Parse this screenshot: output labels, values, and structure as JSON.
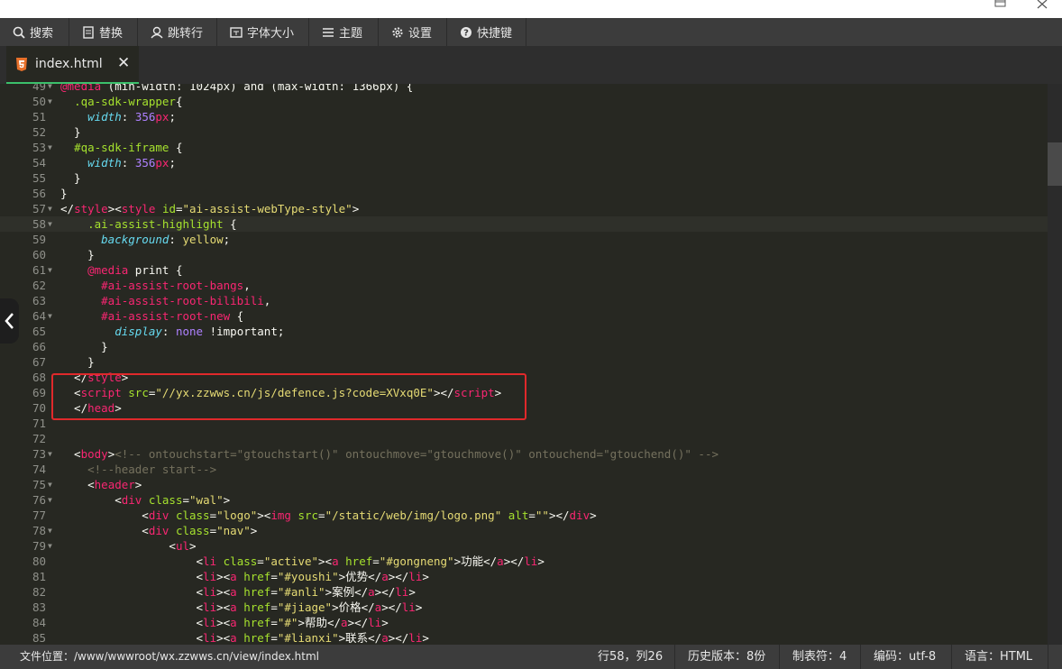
{
  "toolbar": {
    "search": "搜索",
    "replace": "替换",
    "goto_line": "跳转行",
    "font_size": "字体大小",
    "theme": "主题",
    "settings": "设置",
    "shortcuts": "快捷键"
  },
  "tab": {
    "filename": "index.html",
    "close": "✕"
  },
  "editor": {
    "lines": [
      {
        "n": "49",
        "fold": true,
        "code": [
          [
            "t",
            "@media"
          ],
          [
            "w",
            " (min-width: 1024px) and (max-width: 1366px) {"
          ]
        ]
      },
      {
        "n": "50",
        "fold": true,
        "code": [
          [
            "w",
            "  "
          ],
          [
            "a",
            ".qa-sdk-wrapper"
          ],
          [
            "w",
            "{"
          ]
        ]
      },
      {
        "n": "51",
        "fold": false,
        "code": [
          [
            "w",
            "    "
          ],
          [
            "k",
            "width"
          ],
          [
            "w",
            ": "
          ],
          [
            "n",
            "356"
          ],
          [
            "t",
            "px"
          ],
          [
            "w",
            ";"
          ]
        ]
      },
      {
        "n": "52",
        "fold": false,
        "code": [
          [
            "w",
            "  }"
          ]
        ]
      },
      {
        "n": "53",
        "fold": true,
        "code": [
          [
            "w",
            "  "
          ],
          [
            "a",
            "#qa-sdk-iframe"
          ],
          [
            "w",
            " {"
          ]
        ]
      },
      {
        "n": "54",
        "fold": false,
        "code": [
          [
            "w",
            "    "
          ],
          [
            "k",
            "width"
          ],
          [
            "w",
            ": "
          ],
          [
            "n",
            "356"
          ],
          [
            "t",
            "px"
          ],
          [
            "w",
            ";"
          ]
        ]
      },
      {
        "n": "55",
        "fold": false,
        "code": [
          [
            "w",
            "  }"
          ]
        ]
      },
      {
        "n": "56",
        "fold": false,
        "code": [
          [
            "w",
            "}"
          ]
        ]
      },
      {
        "n": "57",
        "fold": true,
        "code": [
          [
            "w",
            "</"
          ],
          [
            "t",
            "style"
          ],
          [
            "w",
            "><"
          ],
          [
            "t",
            "style"
          ],
          [
            "w",
            " "
          ],
          [
            "a",
            "id"
          ],
          [
            "w",
            "="
          ],
          [
            "s",
            "\"ai-assist-webType-style\""
          ],
          [
            "w",
            ">"
          ]
        ]
      },
      {
        "n": "58",
        "fold": true,
        "active": true,
        "code": [
          [
            "w",
            "    "
          ],
          [
            "a",
            ".ai-assist-highlight"
          ],
          [
            "w",
            " {"
          ]
        ]
      },
      {
        "n": "59",
        "fold": false,
        "code": [
          [
            "w",
            "      "
          ],
          [
            "k",
            "background"
          ],
          [
            "w",
            ": "
          ],
          [
            "s",
            "yellow"
          ],
          [
            "w",
            ";"
          ]
        ]
      },
      {
        "n": "60",
        "fold": false,
        "code": [
          [
            "w",
            "    }"
          ]
        ]
      },
      {
        "n": "61",
        "fold": true,
        "code": [
          [
            "w",
            "    "
          ],
          [
            "t",
            "@media"
          ],
          [
            "w",
            " print {"
          ]
        ]
      },
      {
        "n": "62",
        "fold": false,
        "code": [
          [
            "w",
            "      "
          ],
          [
            "t",
            "#ai-assist-root-bangs"
          ],
          [
            "w",
            ","
          ]
        ]
      },
      {
        "n": "63",
        "fold": false,
        "code": [
          [
            "w",
            "      "
          ],
          [
            "t",
            "#ai-assist-root-bilibili"
          ],
          [
            "w",
            ","
          ]
        ]
      },
      {
        "n": "64",
        "fold": true,
        "code": [
          [
            "w",
            "      "
          ],
          [
            "t",
            "#ai-assist-root-new"
          ],
          [
            "w",
            " {"
          ]
        ]
      },
      {
        "n": "65",
        "fold": false,
        "code": [
          [
            "w",
            "        "
          ],
          [
            "k",
            "display"
          ],
          [
            "w",
            ": "
          ],
          [
            "n",
            "none"
          ],
          [
            "w",
            " !important;"
          ]
        ]
      },
      {
        "n": "66",
        "fold": false,
        "code": [
          [
            "w",
            "      }"
          ]
        ]
      },
      {
        "n": "67",
        "fold": false,
        "code": [
          [
            "w",
            "    }"
          ]
        ]
      },
      {
        "n": "68",
        "fold": false,
        "code": [
          [
            "w",
            "  </"
          ],
          [
            "t",
            "style"
          ],
          [
            "w",
            ">"
          ]
        ]
      },
      {
        "n": "69",
        "fold": false,
        "code": [
          [
            "w",
            "  <"
          ],
          [
            "t",
            "script"
          ],
          [
            "w",
            " "
          ],
          [
            "a",
            "src"
          ],
          [
            "w",
            "="
          ],
          [
            "s",
            "\"//yx.zzwws.cn/js/defence.js?code=XVxq0E\""
          ],
          [
            "w",
            "></"
          ],
          [
            "t",
            "script"
          ],
          [
            "w",
            ">"
          ]
        ]
      },
      {
        "n": "70",
        "fold": false,
        "code": [
          [
            "w",
            "  </"
          ],
          [
            "t",
            "head"
          ],
          [
            "w",
            ">"
          ]
        ]
      },
      {
        "n": "71",
        "fold": false,
        "code": []
      },
      {
        "n": "72",
        "fold": false,
        "code": []
      },
      {
        "n": "73",
        "fold": true,
        "code": [
          [
            "w",
            "  <"
          ],
          [
            "t",
            "body"
          ],
          [
            "w",
            ">"
          ],
          [
            "c",
            "<!-- ontouchstart=\"gtouchstart()\" ontouchmove=\"gtouchmove()\" ontouchend=\"gtouchend()\" -->"
          ]
        ]
      },
      {
        "n": "74",
        "fold": false,
        "code": [
          [
            "w",
            "    "
          ],
          [
            "c",
            "<!--header start-->"
          ]
        ]
      },
      {
        "n": "75",
        "fold": true,
        "code": [
          [
            "w",
            "    <"
          ],
          [
            "t",
            "header"
          ],
          [
            "w",
            ">"
          ]
        ]
      },
      {
        "n": "76",
        "fold": true,
        "code": [
          [
            "w",
            "        <"
          ],
          [
            "t",
            "div"
          ],
          [
            "w",
            " "
          ],
          [
            "a",
            "class"
          ],
          [
            "w",
            "="
          ],
          [
            "s",
            "\"wal\""
          ],
          [
            "w",
            ">"
          ]
        ]
      },
      {
        "n": "77",
        "fold": false,
        "code": [
          [
            "w",
            "            <"
          ],
          [
            "t",
            "div"
          ],
          [
            "w",
            " "
          ],
          [
            "a",
            "class"
          ],
          [
            "w",
            "="
          ],
          [
            "s",
            "\"logo\""
          ],
          [
            "w",
            "><"
          ],
          [
            "t",
            "img"
          ],
          [
            "w",
            " "
          ],
          [
            "a",
            "src"
          ],
          [
            "w",
            "="
          ],
          [
            "s",
            "\"/static/web/img/logo.png\""
          ],
          [
            "w",
            " "
          ],
          [
            "a",
            "alt"
          ],
          [
            "w",
            "="
          ],
          [
            "s",
            "\"\""
          ],
          [
            "w",
            "></"
          ],
          [
            "t",
            "div"
          ],
          [
            "w",
            ">"
          ]
        ]
      },
      {
        "n": "78",
        "fold": true,
        "code": [
          [
            "w",
            "            <"
          ],
          [
            "t",
            "div"
          ],
          [
            "w",
            " "
          ],
          [
            "a",
            "class"
          ],
          [
            "w",
            "="
          ],
          [
            "s",
            "\"nav\""
          ],
          [
            "w",
            ">"
          ]
        ]
      },
      {
        "n": "79",
        "fold": true,
        "code": [
          [
            "w",
            "                <"
          ],
          [
            "t",
            "ul"
          ],
          [
            "w",
            ">"
          ]
        ]
      },
      {
        "n": "80",
        "fold": false,
        "code": [
          [
            "w",
            "                    <"
          ],
          [
            "t",
            "li"
          ],
          [
            "w",
            " "
          ],
          [
            "a",
            "class"
          ],
          [
            "w",
            "="
          ],
          [
            "s",
            "\"active\""
          ],
          [
            "w",
            "><"
          ],
          [
            "t",
            "a"
          ],
          [
            "w",
            " "
          ],
          [
            "a",
            "href"
          ],
          [
            "w",
            "="
          ],
          [
            "s",
            "\"#gongneng\""
          ],
          [
            "w",
            ">功能</"
          ],
          [
            "t",
            "a"
          ],
          [
            "w",
            "></"
          ],
          [
            "t",
            "li"
          ],
          [
            "w",
            ">"
          ]
        ]
      },
      {
        "n": "81",
        "fold": false,
        "code": [
          [
            "w",
            "                    <"
          ],
          [
            "t",
            "li"
          ],
          [
            "w",
            "><"
          ],
          [
            "t",
            "a"
          ],
          [
            "w",
            " "
          ],
          [
            "a",
            "href"
          ],
          [
            "w",
            "="
          ],
          [
            "s",
            "\"#youshi\""
          ],
          [
            "w",
            ">优势</"
          ],
          [
            "t",
            "a"
          ],
          [
            "w",
            "></"
          ],
          [
            "t",
            "li"
          ],
          [
            "w",
            ">"
          ]
        ]
      },
      {
        "n": "82",
        "fold": false,
        "code": [
          [
            "w",
            "                    <"
          ],
          [
            "t",
            "li"
          ],
          [
            "w",
            "><"
          ],
          [
            "t",
            "a"
          ],
          [
            "w",
            " "
          ],
          [
            "a",
            "href"
          ],
          [
            "w",
            "="
          ],
          [
            "s",
            "\"#anli\""
          ],
          [
            "w",
            ">案例</"
          ],
          [
            "t",
            "a"
          ],
          [
            "w",
            "></"
          ],
          [
            "t",
            "li"
          ],
          [
            "w",
            ">"
          ]
        ]
      },
      {
        "n": "83",
        "fold": false,
        "code": [
          [
            "w",
            "                    <"
          ],
          [
            "t",
            "li"
          ],
          [
            "w",
            "><"
          ],
          [
            "t",
            "a"
          ],
          [
            "w",
            " "
          ],
          [
            "a",
            "href"
          ],
          [
            "w",
            "="
          ],
          [
            "s",
            "\"#jiage\""
          ],
          [
            "w",
            ">价格</"
          ],
          [
            "t",
            "a"
          ],
          [
            "w",
            "></"
          ],
          [
            "t",
            "li"
          ],
          [
            "w",
            ">"
          ]
        ]
      },
      {
        "n": "84",
        "fold": false,
        "code": [
          [
            "w",
            "                    <"
          ],
          [
            "t",
            "li"
          ],
          [
            "w",
            "><"
          ],
          [
            "t",
            "a"
          ],
          [
            "w",
            " "
          ],
          [
            "a",
            "href"
          ],
          [
            "w",
            "="
          ],
          [
            "s",
            "\"#\""
          ],
          [
            "w",
            ">帮助</"
          ],
          [
            "t",
            "a"
          ],
          [
            "w",
            "></"
          ],
          [
            "t",
            "li"
          ],
          [
            "w",
            ">"
          ]
        ]
      },
      {
        "n": "85",
        "fold": false,
        "code": [
          [
            "w",
            "                    <"
          ],
          [
            "t",
            "li"
          ],
          [
            "w",
            "><"
          ],
          [
            "t",
            "a"
          ],
          [
            "w",
            " "
          ],
          [
            "a",
            "href"
          ],
          [
            "w",
            "="
          ],
          [
            "s",
            "\"#lianxi\""
          ],
          [
            "w",
            ">联系</"
          ],
          [
            "t",
            "a"
          ],
          [
            "w",
            "></"
          ],
          [
            "t",
            "li"
          ],
          [
            "w",
            ">"
          ]
        ]
      }
    ]
  },
  "status": {
    "file_location": "文件位置：/www/wwwroot/wx.zzwws.cn/view/index.html",
    "cursor": "行58，列26",
    "history": "历史版本：8份",
    "tab_size": "制表符：4",
    "encoding": "编码：utf-8",
    "language": "语言：HTML"
  },
  "colors": {
    "background": "#272822",
    "toolbar": "#3c3c3c",
    "tab_accent": "#3bc06b",
    "highlight_box": "#e0292b"
  }
}
